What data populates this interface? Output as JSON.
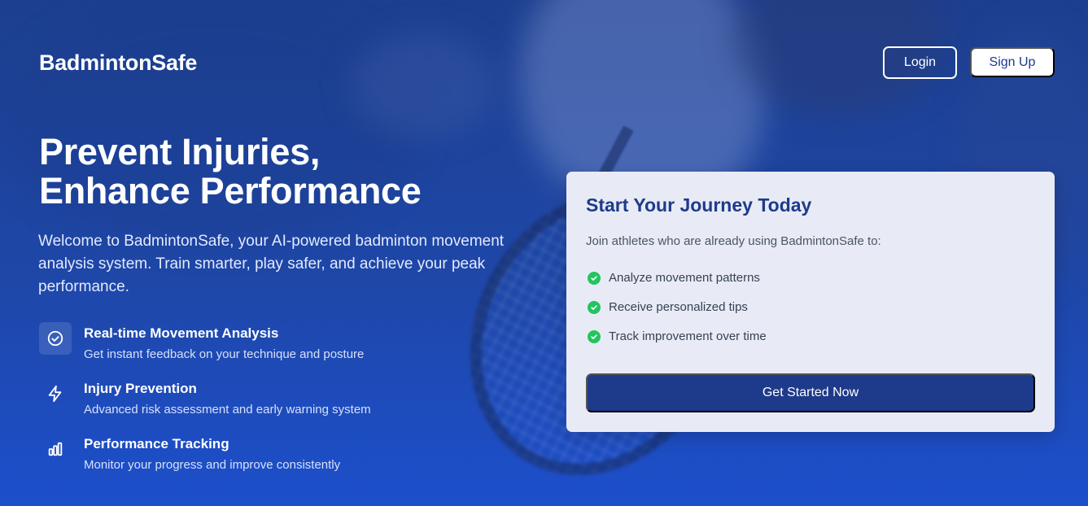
{
  "header": {
    "brand": "BadmintonSafe",
    "login_label": "Login",
    "signup_label": "Sign Up"
  },
  "hero": {
    "title_line1": "Prevent Injuries,",
    "title_line2": "Enhance Performance",
    "description": "Welcome to BadmintonSafe, your AI-powered badminton movement analysis system. Train smarter, play safer, and achieve your peak performance."
  },
  "features": [
    {
      "icon": "check-circle-icon",
      "title": "Real-time Movement Analysis",
      "description": "Get instant feedback on your technique and posture"
    },
    {
      "icon": "lightning-icon",
      "title": "Injury Prevention",
      "description": "Advanced risk assessment and early warning system"
    },
    {
      "icon": "bar-chart-icon",
      "title": "Performance Tracking",
      "description": "Monitor your progress and improve consistently"
    }
  ],
  "card": {
    "title": "Start Your Journey Today",
    "subtitle": "Join athletes who are already using BadmintonSafe to:",
    "items": [
      "Analyze movement patterns",
      "Receive personalized tips",
      "Track improvement over time"
    ],
    "cta_label": "Get Started Now"
  },
  "colors": {
    "primary": "#1e3a8a",
    "check": "#22c55e",
    "card_bg": "#e8ebf6"
  }
}
